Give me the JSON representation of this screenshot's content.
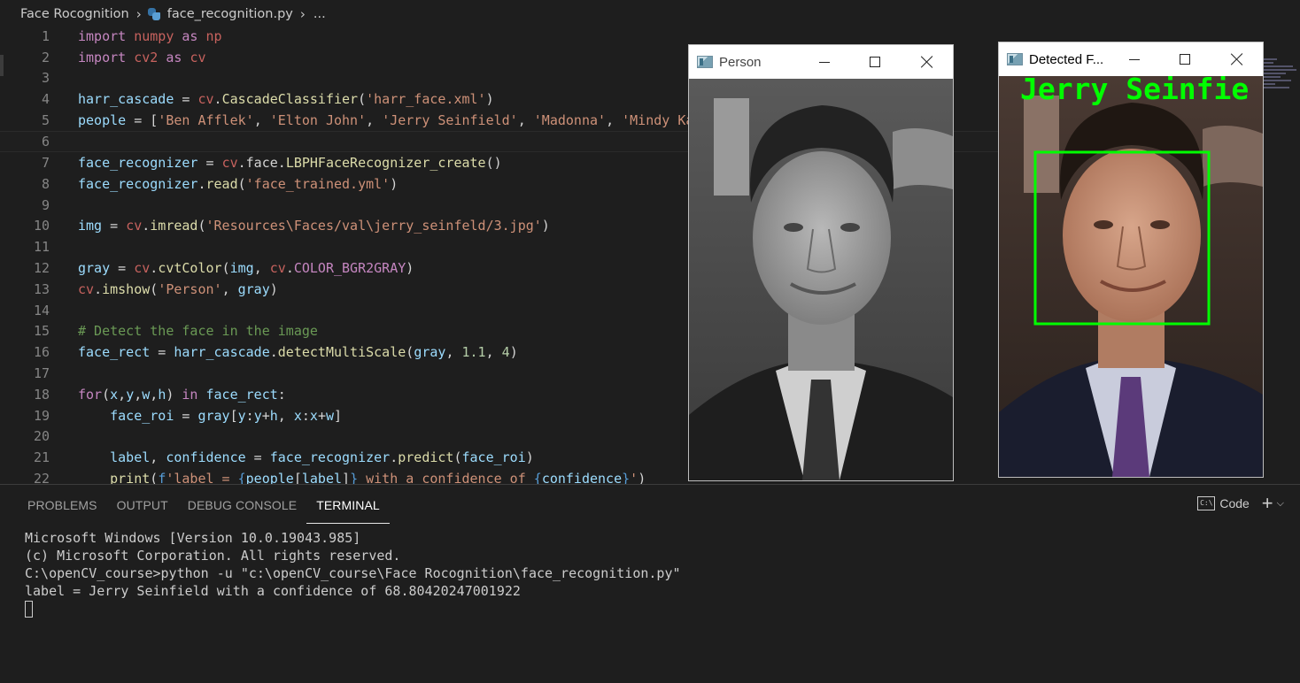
{
  "breadcrumb": {
    "folder": "Face Rocognition",
    "file": "face_recognition.py",
    "more": "..."
  },
  "editor": {
    "line_numbers": [
      "1",
      "2",
      "3",
      "4",
      "5",
      "6",
      "7",
      "8",
      "9",
      "10",
      "11",
      "12",
      "13",
      "14",
      "15",
      "16",
      "17",
      "18",
      "19",
      "20",
      "21",
      "22"
    ],
    "lines": [
      "import numpy as np",
      "import cv2 as cv",
      "",
      "harr_cascade = cv.CascadeClassifier('harr_face.xml')",
      "people = ['Ben Afflek', 'Elton John', 'Jerry Seinfield', 'Madonna', 'Mindy Kaling']",
      "",
      "face_recognizer = cv.face.LBPHFaceRecognizer_create()",
      "face_recognizer.read('face_trained.yml')",
      "",
      "img = cv.imread('Resources\\Faces/val\\jerry_seinfeld/3.jpg')",
      "",
      "gray = cv.cvtColor(img, cv.COLOR_BGR2GRAY)",
      "cv.imshow('Person', gray)",
      "",
      "# Detect the face in the image",
      "face_rect = harr_cascade.detectMultiScale(gray, 1.1, 4)",
      "",
      "for(x,y,w,h) in face_rect:",
      "    face_roi = gray[y:y+h, x:x+w]",
      "",
      "    label, confidence = face_recognizer.predict(face_roi)",
      "    print(f'label = {people[label]} with a confidence of {confidence}')"
    ],
    "current_line": 6
  },
  "window_person": {
    "title": "Person"
  },
  "window_detected": {
    "title": "Detected F...",
    "overlay_text": "Jerry Seinfie",
    "box_color": "#00ff00"
  },
  "panel": {
    "tabs": [
      "PROBLEMS",
      "OUTPUT",
      "DEBUG CONSOLE",
      "TERMINAL"
    ],
    "active_tab": "TERMINAL",
    "terminal_selector": "Code",
    "terminal_lines": [
      "Microsoft Windows [Version 10.0.19043.985]",
      "(c) Microsoft Corporation. All rights reserved.",
      "",
      "C:\\openCV_course>python -u \"c:\\openCV_course\\Face Rocognition\\face_recognition.py\"",
      "label = Jerry Seinfield with a confidence of 68.80420247001922"
    ]
  },
  "icons": [
    "python-file-icon",
    "opencv-window-icon",
    "minimize-icon",
    "maximize-icon",
    "close-icon",
    "terminal-icon",
    "plus-icon",
    "chevron-down-icon"
  ]
}
